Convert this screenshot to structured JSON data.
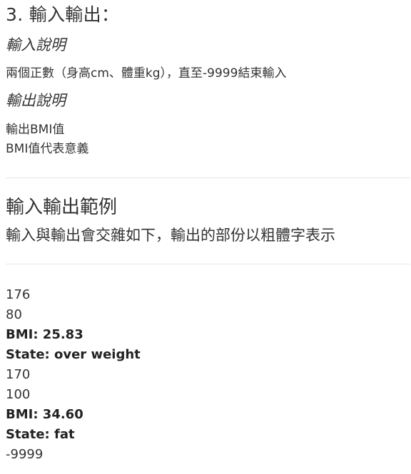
{
  "input_output": {
    "heading": "3. 輸入輸出：",
    "input_title": "輸入說明",
    "input_text": "兩個正數（身高cm、體重kg），直至-9999結束輸入",
    "output_title": "輸出說明",
    "output_lines": [
      "輸出BMI值",
      "BMI值代表意義"
    ]
  },
  "example": {
    "heading": "輸入輸出範例",
    "description": "輸入與輸出會交雜如下，輸出的部份以粗體字表示",
    "lines": [
      {
        "text": "176",
        "bold": false
      },
      {
        "text": "80",
        "bold": false
      },
      {
        "text": "BMI: 25.83",
        "bold": true
      },
      {
        "text": "State: over weight",
        "bold": true
      },
      {
        "text": "170",
        "bold": false
      },
      {
        "text": "100",
        "bold": false
      },
      {
        "text": "BMI: 34.60",
        "bold": true
      },
      {
        "text": "State: fat",
        "bold": true
      },
      {
        "text": "-9999",
        "bold": false
      }
    ]
  }
}
